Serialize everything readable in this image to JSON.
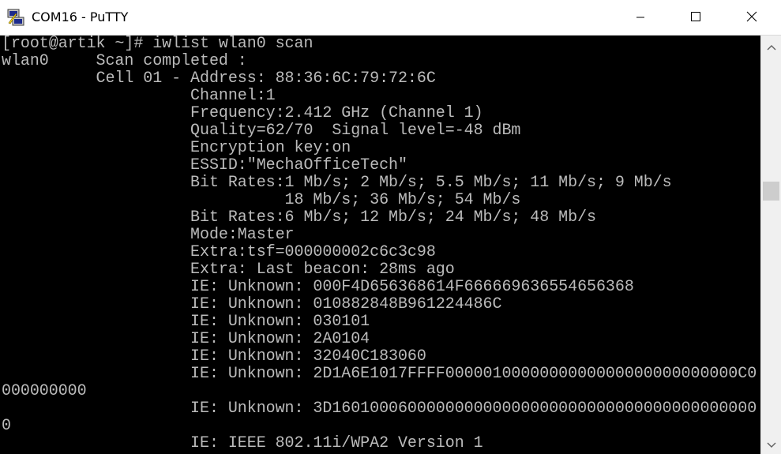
{
  "window": {
    "title": "COM16 - PuTTY",
    "icon": "putty-icon"
  },
  "controls": {
    "minimize": "minimize-icon",
    "maximize": "maximize-icon",
    "close": "close-icon"
  },
  "terminal": {
    "foreground": "#bbbbbb",
    "background": "#000000",
    "lines": [
      "[root@artik ~]# iwlist wlan0 scan",
      "wlan0     Scan completed :",
      "          Cell 01 - Address: 88:36:6C:79:72:6C",
      "                    Channel:1",
      "                    Frequency:2.412 GHz (Channel 1)",
      "                    Quality=62/70  Signal level=-48 dBm",
      "                    Encryption key:on",
      "                    ESSID:\"MechaOfficeTech\"",
      "                    Bit Rates:1 Mb/s; 2 Mb/s; 5.5 Mb/s; 11 Mb/s; 9 Mb/s",
      "                              18 Mb/s; 36 Mb/s; 54 Mb/s",
      "                    Bit Rates:6 Mb/s; 12 Mb/s; 24 Mb/s; 48 Mb/s",
      "                    Mode:Master",
      "                    Extra:tsf=000000002c6c3c98",
      "                    Extra: Last beacon: 28ms ago",
      "                    IE: Unknown: 000F4D656368614F666669636554656368",
      "                    IE: Unknown: 010882848B961224486C",
      "                    IE: Unknown: 030101",
      "                    IE: Unknown: 2A0104",
      "                    IE: Unknown: 32040C183060",
      "                    IE: Unknown: 2D1A6E1017FFFF0000010000000000000000000000000C0",
      "000000000",
      "                    IE: Unknown: 3D160100060000000000000000000000000000000000000",
      "0",
      "                    IE: IEEE 802.11i/WPA2 Version 1"
    ]
  },
  "scrollbar": {
    "up": "scroll-up-arrow-icon",
    "down": "scroll-down-arrow-icon",
    "position": 0.35
  }
}
